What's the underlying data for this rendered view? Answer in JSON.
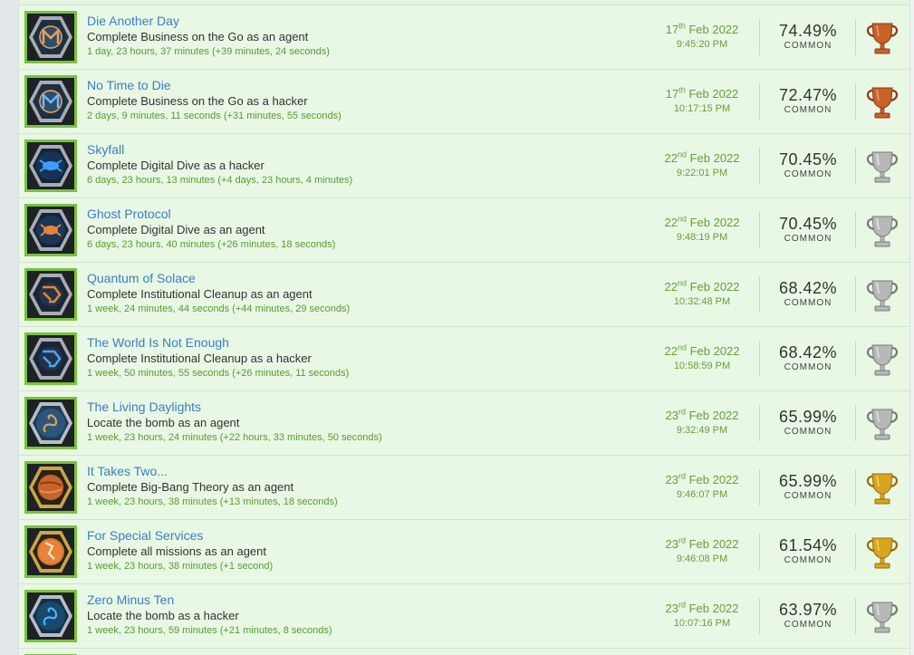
{
  "colors": {
    "row_bg": "#e8f8e5",
    "title": "#3a7fc2",
    "time_green": "#5a9a30",
    "thumb_border": "#78c33a",
    "bronze": "#c8612a",
    "silver": "#b8b8b8",
    "gold": "#d9a41f"
  },
  "rows": [
    {
      "title": "Die Another Day",
      "description": "Complete Business on the Go as an agent",
      "time": "1 day, 23 hours, 37 minutes (+39 minutes, 24 seconds)",
      "date_day": "17",
      "date_suffix": "th",
      "date_rest": " Feb 2022",
      "date_time": "9:45:20 PM",
      "percent": "74.49%",
      "rarity": "COMMON",
      "trophy": "bronze",
      "icon": "business-agent-icon"
    },
    {
      "title": "No Time to Die",
      "description": "Complete Business on the Go as a hacker",
      "time": "2 days, 9 minutes, 11 seconds (+31 minutes, 55 seconds)",
      "date_day": "17",
      "date_suffix": "th",
      "date_rest": " Feb 2022",
      "date_time": "10:17:15 PM",
      "percent": "72.47%",
      "rarity": "COMMON",
      "trophy": "bronze",
      "icon": "business-hacker-icon"
    },
    {
      "title": "Skyfall",
      "description": "Complete Digital Dive as a hacker",
      "time": "6 days, 23 hours, 13 minutes (+4 days, 23 hours, 4 minutes)",
      "date_day": "22",
      "date_suffix": "nd",
      "date_rest": " Feb 2022",
      "date_time": "9:22:01 PM",
      "percent": "70.45%",
      "rarity": "COMMON",
      "trophy": "silver",
      "icon": "digital-dive-hacker-icon"
    },
    {
      "title": "Ghost Protocol",
      "description": "Complete Digital Dive as an agent",
      "time": "6 days, 23 hours, 40 minutes (+26 minutes, 18 seconds)",
      "date_day": "22",
      "date_suffix": "nd",
      "date_rest": " Feb 2022",
      "date_time": "9:48:19 PM",
      "percent": "70.45%",
      "rarity": "COMMON",
      "trophy": "silver",
      "icon": "digital-dive-agent-icon"
    },
    {
      "title": "Quantum of Solace",
      "description": "Complete Institutional Cleanup as an agent",
      "time": "1 week, 24 minutes, 44 seconds (+44 minutes, 29 seconds)",
      "date_day": "22",
      "date_suffix": "nd",
      "date_rest": " Feb 2022",
      "date_time": "10:32:48 PM",
      "percent": "68.42%",
      "rarity": "COMMON",
      "trophy": "silver",
      "icon": "cleanup-agent-icon"
    },
    {
      "title": "The World Is Not Enough",
      "description": "Complete Institutional Cleanup as a hacker",
      "time": "1 week, 50 minutes, 55 seconds (+26 minutes, 11 seconds)",
      "date_day": "22",
      "date_suffix": "nd",
      "date_rest": " Feb 2022",
      "date_time": "10:58:59 PM",
      "percent": "68.42%",
      "rarity": "COMMON",
      "trophy": "silver",
      "icon": "cleanup-hacker-icon"
    },
    {
      "title": "The Living Daylights",
      "description": "Locate the bomb as an agent",
      "time": "1 week, 23 hours, 24 minutes (+22 hours, 33 minutes, 50 seconds)",
      "date_day": "23",
      "date_suffix": "rd",
      "date_rest": " Feb 2022",
      "date_time": "9:32:49 PM",
      "percent": "65.99%",
      "rarity": "COMMON",
      "trophy": "silver",
      "icon": "dragon-agent-icon"
    },
    {
      "title": "It Takes Two...",
      "description": "Complete Big-Bang Theory as an agent",
      "time": "1 week, 23 hours, 38 minutes (+13 minutes, 18 seconds)",
      "date_day": "23",
      "date_suffix": "rd",
      "date_rest": " Feb 2022",
      "date_time": "9:46:07 PM",
      "percent": "65.99%",
      "rarity": "COMMON",
      "trophy": "gold",
      "icon": "planet-icon"
    },
    {
      "title": "For Special Services",
      "description": "Complete all missions as an agent",
      "time": "1 week, 23 hours, 38 minutes (+1 second)",
      "date_day": "23",
      "date_suffix": "rd",
      "date_rest": " Feb 2022",
      "date_time": "9:46:08 PM",
      "percent": "61.54%",
      "rarity": "COMMON",
      "trophy": "gold",
      "icon": "globe-agent-icon"
    },
    {
      "title": "Zero Minus Ten",
      "description": "Locate the bomb as a hacker",
      "time": "1 week, 23 hours, 59 minutes (+21 minutes, 8 seconds)",
      "date_day": "23",
      "date_suffix": "rd",
      "date_rest": " Feb 2022",
      "date_time": "10:07:16 PM",
      "percent": "63.97%",
      "rarity": "COMMON",
      "trophy": "silver",
      "icon": "dragon-hacker-icon"
    }
  ]
}
